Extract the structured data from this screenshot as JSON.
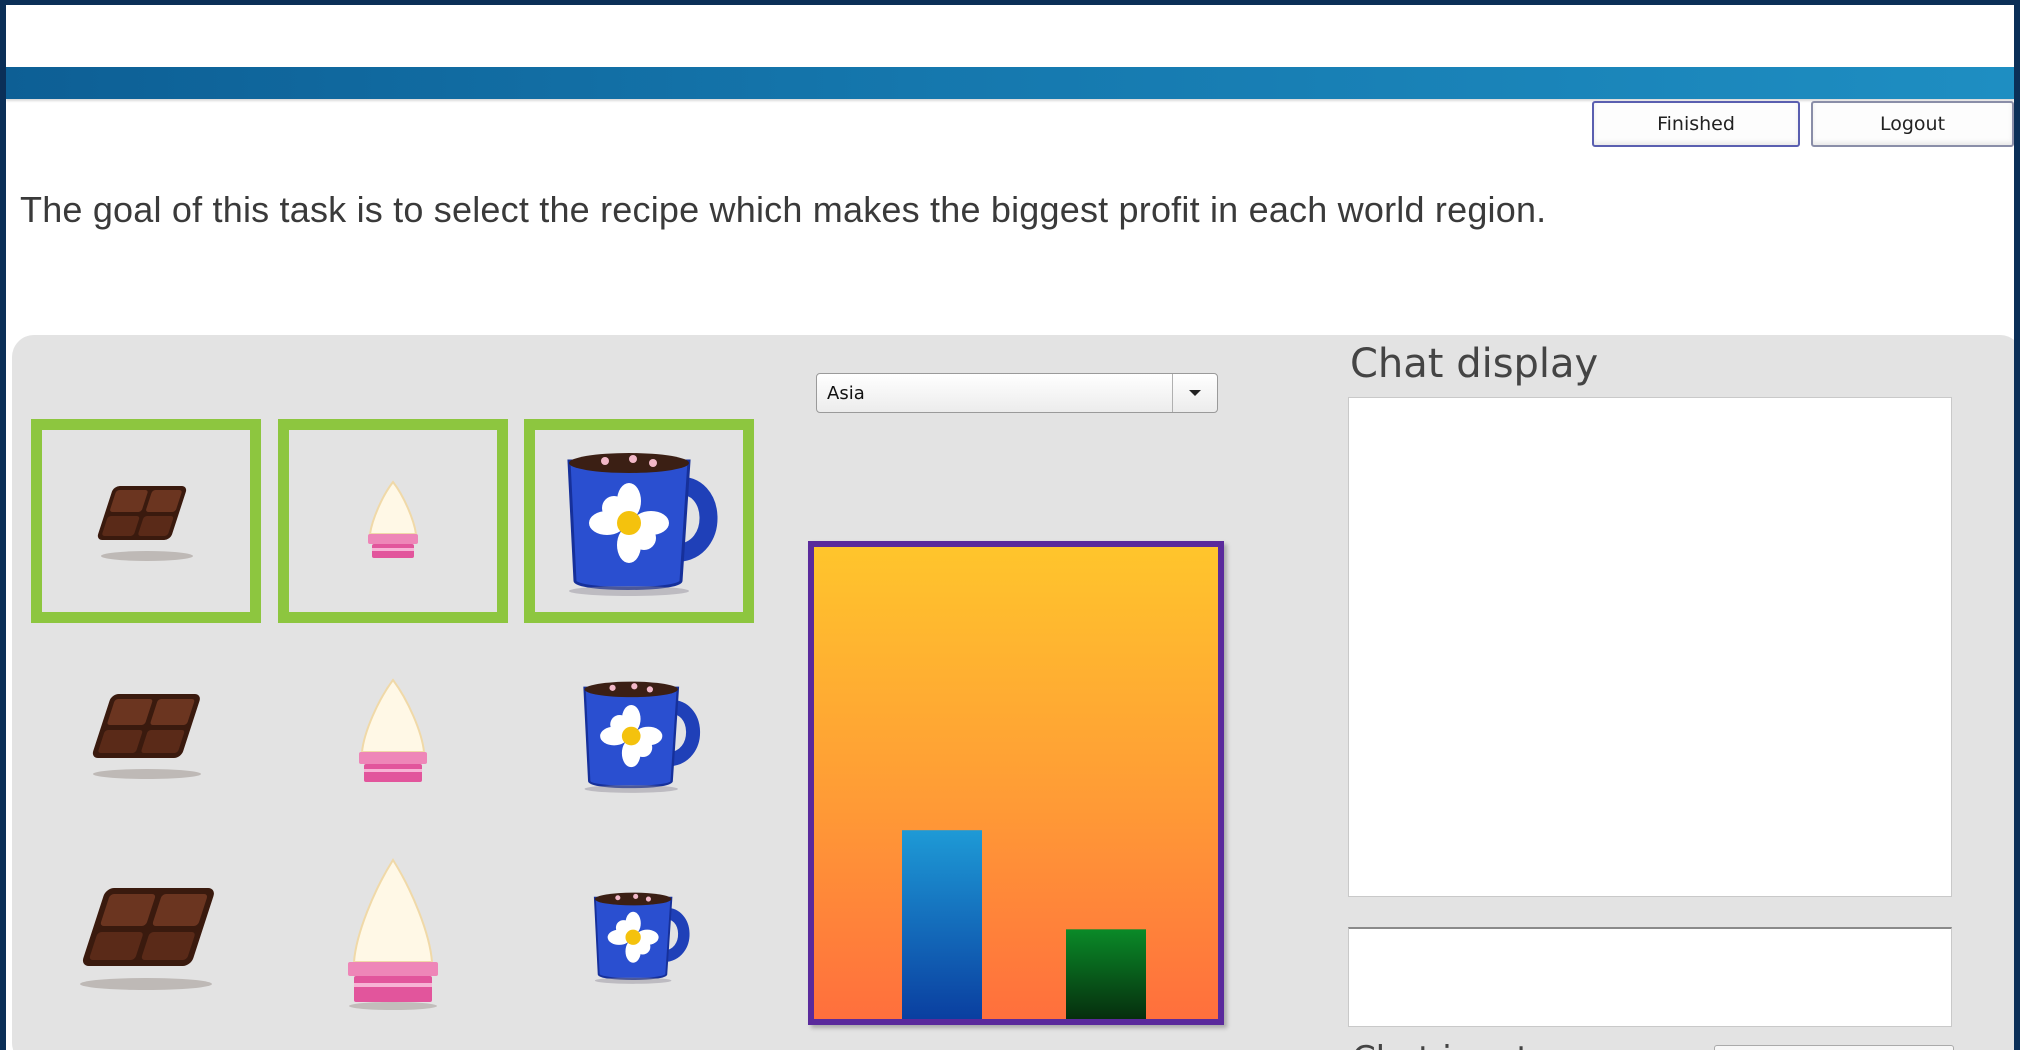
{
  "header": {
    "finished_label": "Finished",
    "logout_label": "Logout"
  },
  "goal_text": "The goal of this task is to select the recipe which makes the biggest profit in each world region.",
  "recipe_grid": {
    "columns": [
      "chocolate",
      "cream",
      "mug"
    ],
    "rows": [
      "small",
      "medium",
      "large"
    ],
    "selected": [
      "chocolate",
      "cream",
      "mug"
    ]
  },
  "region_select": {
    "selected": "Asia"
  },
  "profit_chart": {
    "colors": {
      "bar1": "#0a64b8",
      "bar2": "#0a5a18",
      "border": "#5a2a9c"
    }
  },
  "chart_data": {
    "type": "bar",
    "categories": [
      "",
      ""
    ],
    "values": [
      40,
      19
    ],
    "ylim": [
      0,
      100
    ],
    "title": "",
    "xlabel": "",
    "ylabel": ""
  },
  "chat": {
    "display_title": "Chat display",
    "input_title": "Chat input"
  },
  "colors": {
    "selection": "#8dc63f",
    "header_bar": "#1577ad",
    "panel": "#e3e3e3"
  }
}
